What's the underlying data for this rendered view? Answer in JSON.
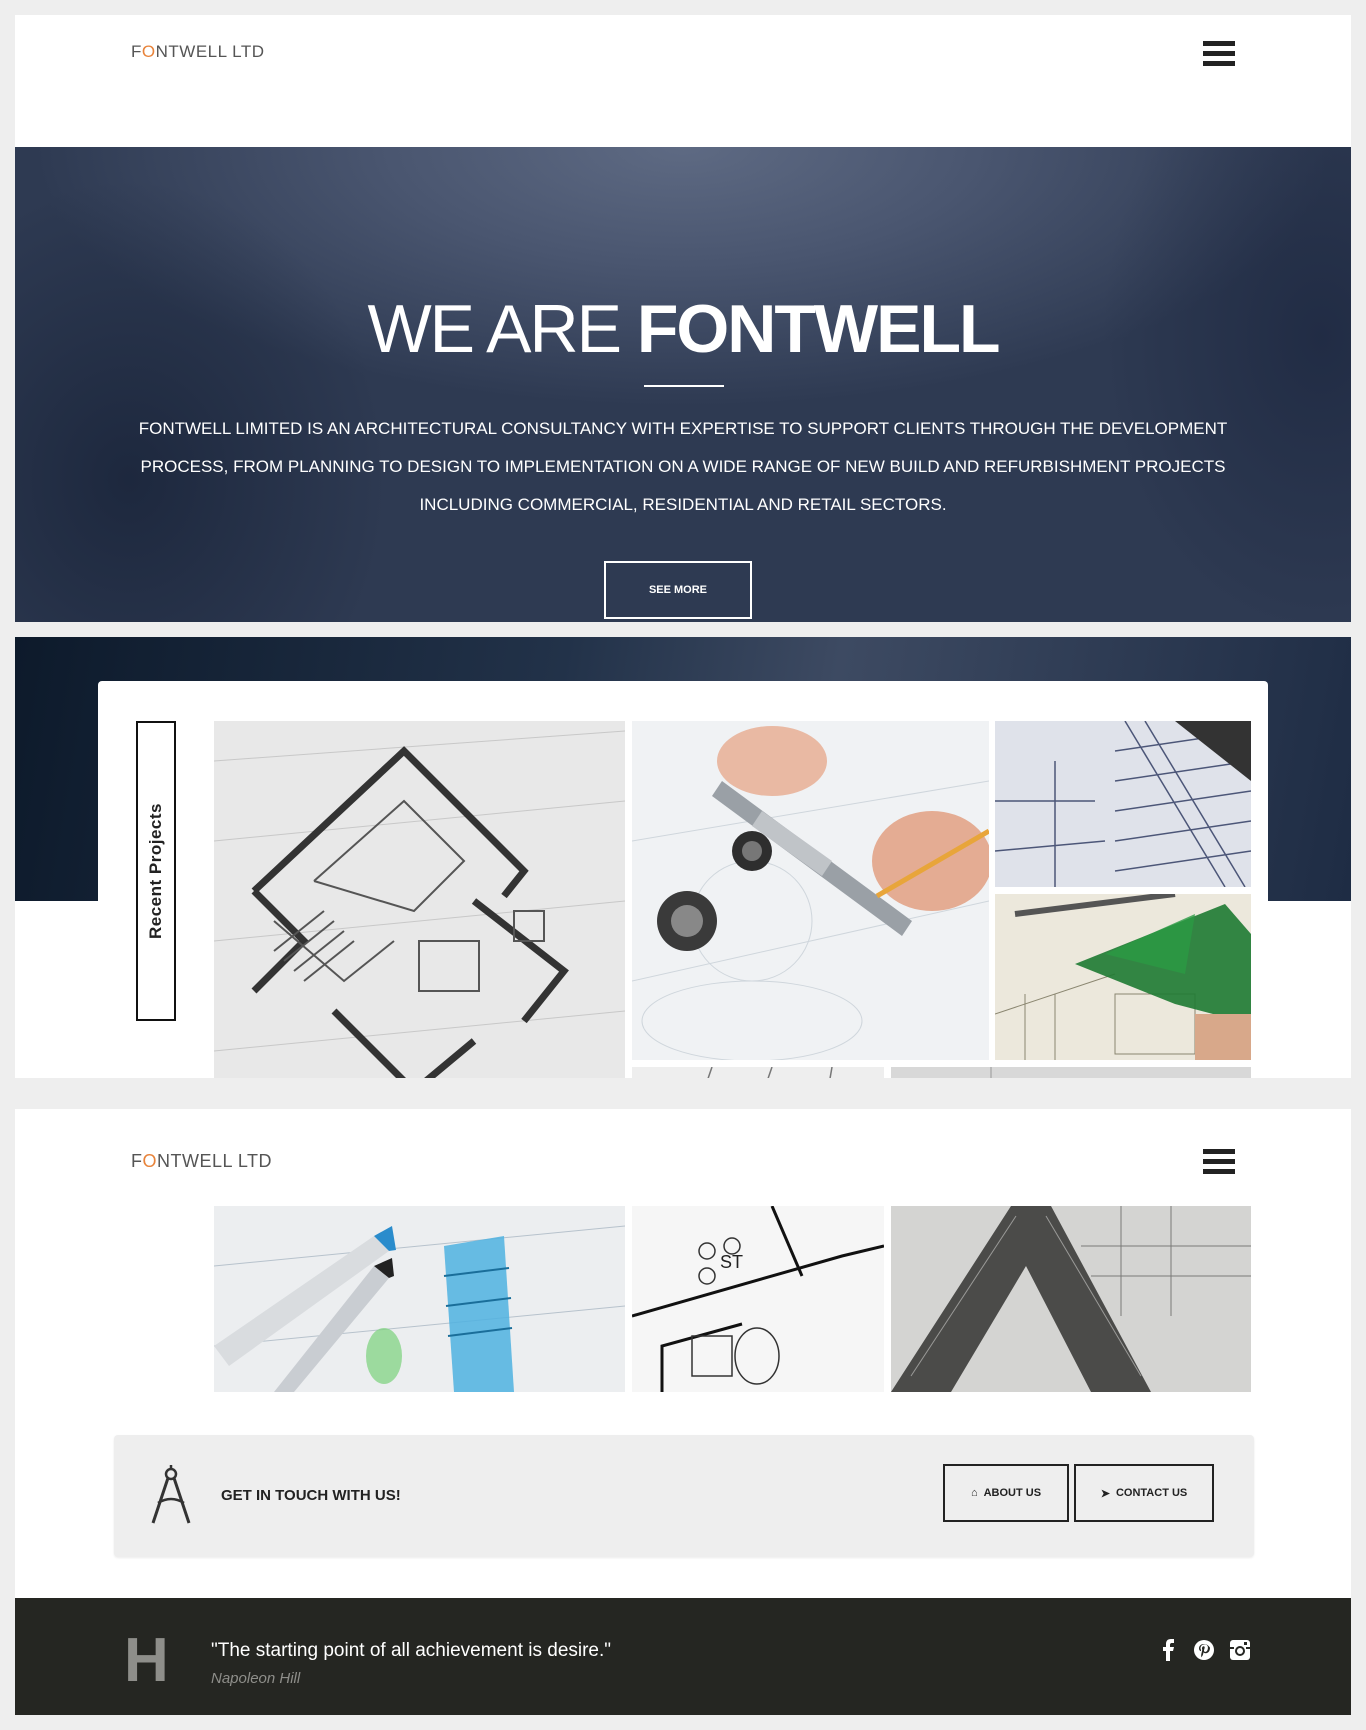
{
  "brand": {
    "name_part1": "F",
    "name_o": "O",
    "name_part2": "NTWELL LTD",
    "accent": "#e8833a"
  },
  "nav": {
    "menu_icon": "hamburger-icon"
  },
  "hero": {
    "title_light": "WE ARE ",
    "title_bold": "FONTWELL",
    "description": "FONTWELL LIMITED IS AN ARCHITECTURAL CONSULTANCY WITH EXPERTISE TO SUPPORT CLIENTS THROUGH THE DEVELOPMENT PROCESS, FROM PLANNING TO DESIGN TO IMPLEMENTATION ON A WIDE RANGE OF NEW BUILD AND REFURBISHMENT PROJECTS INCLUDING COMMERCIAL, RESIDENTIAL AND RETAIL SECTORS.",
    "button": "SEE MORE"
  },
  "projects": {
    "label": "Recent Projects"
  },
  "contact": {
    "icon": "compass-icon",
    "heading": "GET IN TOUCH WITH US!",
    "about_button": "ABOUT US",
    "about_icon": "home-icon",
    "contact_button": "CONTACT US",
    "contact_icon": "paper-plane-icon"
  },
  "footer": {
    "letter": "H",
    "quote": "\"The starting point of all achievement is desire.\"",
    "author": "Napoleon Hill",
    "social": [
      "facebook-icon",
      "pinterest-icon",
      "instagram-icon"
    ]
  }
}
